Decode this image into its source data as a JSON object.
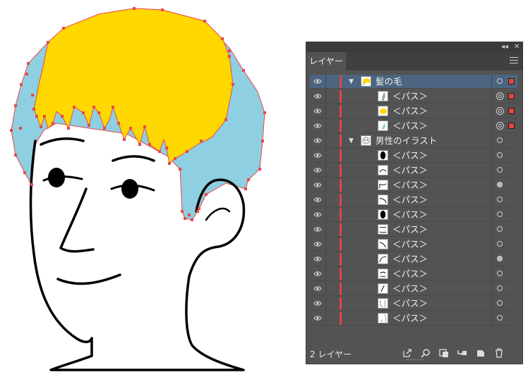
{
  "panel": {
    "tab_label": "レイヤー",
    "collapse_icon": "double-chevron-left-icon",
    "close_icon": "close-icon",
    "menu_icon": "hamburger-menu-icon",
    "footer_count": "2 レイヤー",
    "footer_icons": [
      "export-icon",
      "search-icon",
      "clipping-mask-icon",
      "new-sublayer-icon",
      "new-layer-icon",
      "trash-icon"
    ],
    "layer_color": "#e24444",
    "selection_color": "#4b6480",
    "rows": [
      {
        "label": "髪の毛",
        "type": "layer",
        "expanded": true,
        "selected": true,
        "target": "single",
        "has_selection_square": true,
        "thumb": "hair"
      },
      {
        "label": "＜パス＞",
        "type": "path",
        "target": "double",
        "has_selection_square": true,
        "thumb": "strand-blue"
      },
      {
        "label": "＜パス＞",
        "type": "path",
        "target": "double",
        "has_selection_square": true,
        "thumb": "yellow-blob"
      },
      {
        "label": "＜パス＞",
        "type": "path",
        "target": "double",
        "has_selection_square": true,
        "thumb": "blue-shape"
      },
      {
        "label": "男性のイラスト",
        "type": "layer",
        "expanded": true,
        "selected": false,
        "target": "single",
        "thumb": "face"
      },
      {
        "label": "＜パス＞",
        "type": "path",
        "target": "single",
        "thumb": "black-oval"
      },
      {
        "label": "＜パス＞",
        "type": "path",
        "target": "single",
        "thumb": "arc"
      },
      {
        "label": "＜パス＞",
        "type": "path",
        "target": "filled",
        "thumb": "curve-a"
      },
      {
        "label": "＜パス＞",
        "type": "path",
        "target": "single",
        "thumb": "curve-b"
      },
      {
        "label": "＜パス＞",
        "type": "path",
        "target": "single",
        "thumb": "black-oval"
      },
      {
        "label": "＜パス＞",
        "type": "path",
        "target": "single",
        "thumb": "line-h"
      },
      {
        "label": "＜パス＞",
        "type": "path",
        "target": "single",
        "thumb": "curve-c"
      },
      {
        "label": "＜パス＞",
        "type": "path",
        "target": "filled",
        "thumb": "curve-d"
      },
      {
        "label": "＜パス＞",
        "type": "path",
        "target": "single",
        "thumb": "curve-e"
      },
      {
        "label": "＜パス＞",
        "type": "path",
        "target": "single",
        "thumb": "slash"
      },
      {
        "label": "＜パス＞",
        "type": "path",
        "target": "single",
        "thumb": "face-outline"
      },
      {
        "label": "＜パス＞",
        "type": "path",
        "target": "single",
        "thumb": "neck"
      }
    ]
  },
  "artwork": {
    "hair_yellow": "#ffd800",
    "hair_blue": "#8ecfe1",
    "anchor_color": "#e8484a",
    "line_color": "#000000"
  }
}
